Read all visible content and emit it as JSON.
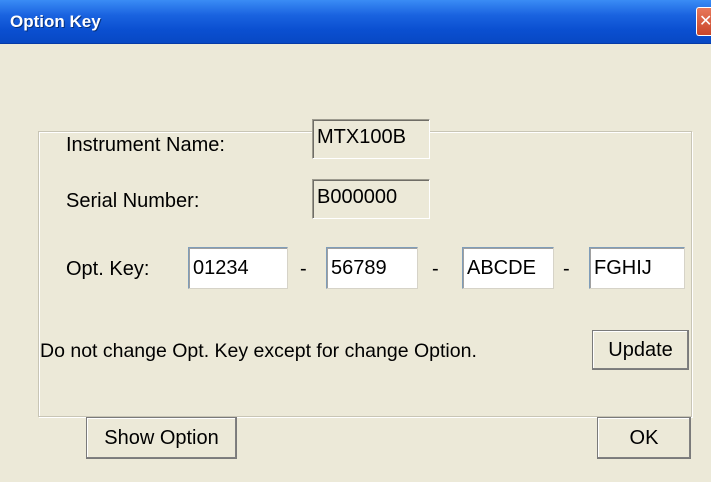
{
  "window": {
    "title": "Option Key",
    "close_symbol": "✕"
  },
  "fields": {
    "instrument_name_label": "Instrument Name:",
    "instrument_name_value": "MTX100B",
    "serial_number_label": "Serial Number:",
    "serial_number_value": "B000000",
    "opt_key_label": "Opt. Key:",
    "opt_key_parts": [
      "01234",
      "56789",
      "ABCDE",
      "FGHIJ"
    ],
    "separator": "-"
  },
  "note": "Do not change Opt. Key except for change Option.",
  "buttons": {
    "update": "Update",
    "show_option": "Show Option",
    "ok": "OK"
  },
  "colors": {
    "titlebar": "#0a4fd0",
    "dialog_bg": "#ece9d8",
    "close_button": "#c9452a"
  }
}
